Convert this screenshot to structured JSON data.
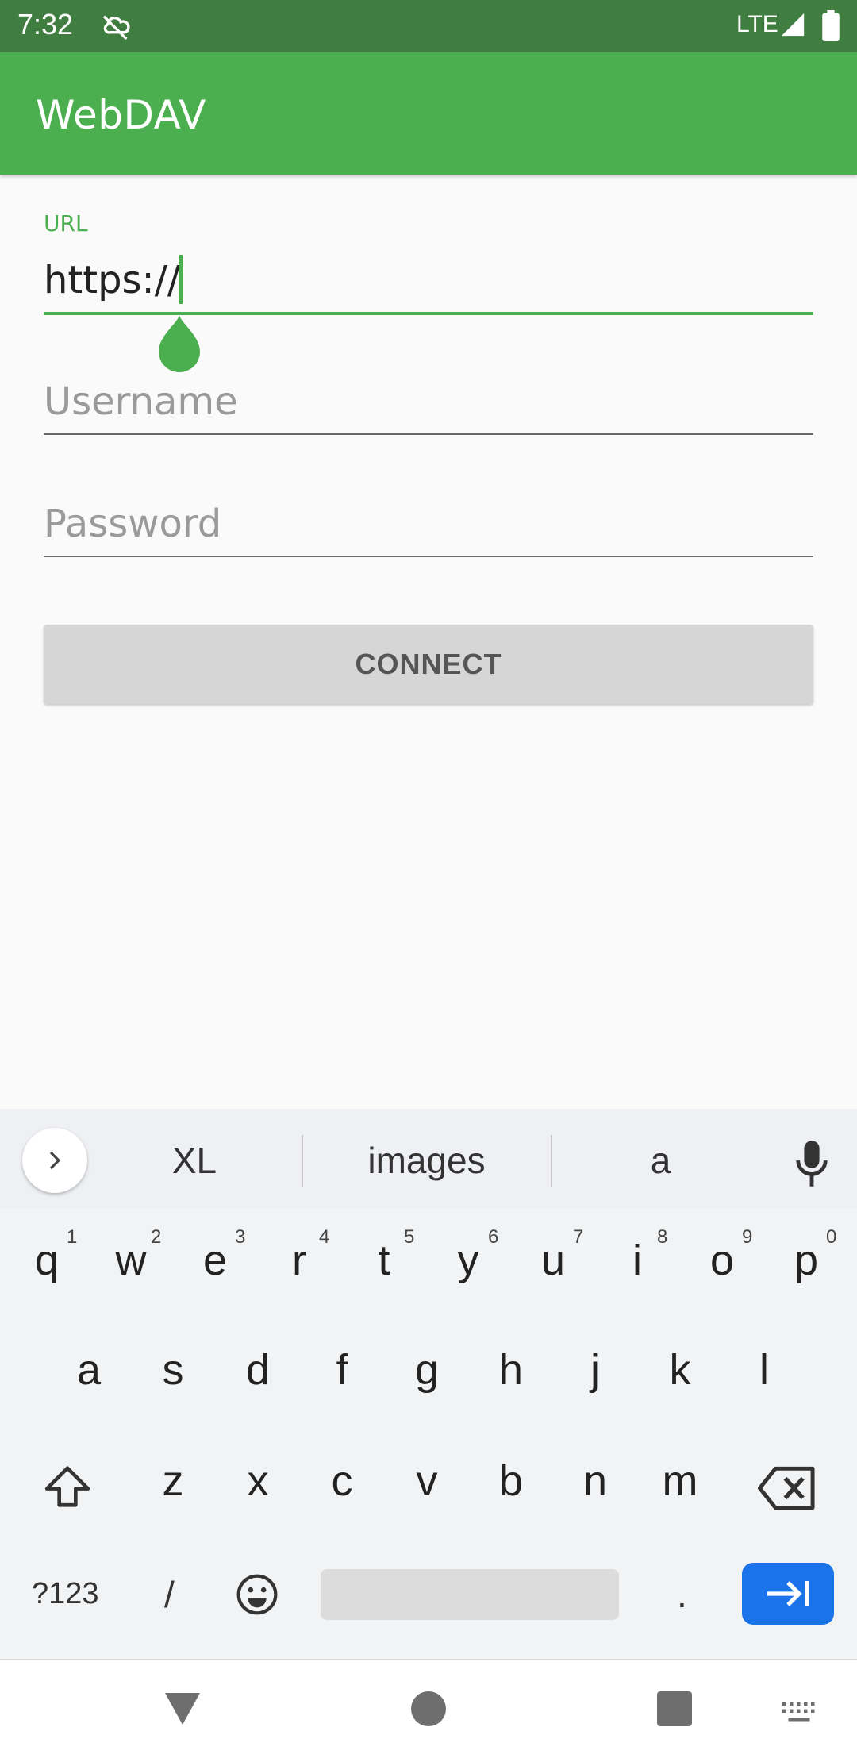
{
  "status_bar": {
    "time": "7:32",
    "network": "LTE",
    "icons": [
      "cloud-off-icon",
      "signal-icon",
      "battery-icon"
    ]
  },
  "app_bar": {
    "title": "WebDAV",
    "color": "#4caf4f"
  },
  "form": {
    "url": {
      "label": "URL",
      "value": "https://"
    },
    "username": {
      "placeholder": "Username",
      "value": ""
    },
    "password": {
      "placeholder": "Password",
      "value": ""
    },
    "connect_label": "CONNECT"
  },
  "keyboard": {
    "suggestions": [
      "XL",
      "images",
      "a"
    ],
    "row1": [
      {
        "key": "q",
        "num": "1"
      },
      {
        "key": "w",
        "num": "2"
      },
      {
        "key": "e",
        "num": "3"
      },
      {
        "key": "r",
        "num": "4"
      },
      {
        "key": "t",
        "num": "5"
      },
      {
        "key": "y",
        "num": "6"
      },
      {
        "key": "u",
        "num": "7"
      },
      {
        "key": "i",
        "num": "8"
      },
      {
        "key": "o",
        "num": "9"
      },
      {
        "key": "p",
        "num": "0"
      }
    ],
    "row2": [
      "a",
      "s",
      "d",
      "f",
      "g",
      "h",
      "j",
      "k",
      "l"
    ],
    "row3": [
      "z",
      "x",
      "c",
      "v",
      "b",
      "n",
      "m"
    ],
    "symbols_label": "?123",
    "slash": "/",
    "period": ".",
    "enter_color": "#1a73e8"
  },
  "nav_bar": {
    "icons": [
      "back-icon",
      "home-icon",
      "recents-icon",
      "keyboard-switch-icon"
    ]
  }
}
